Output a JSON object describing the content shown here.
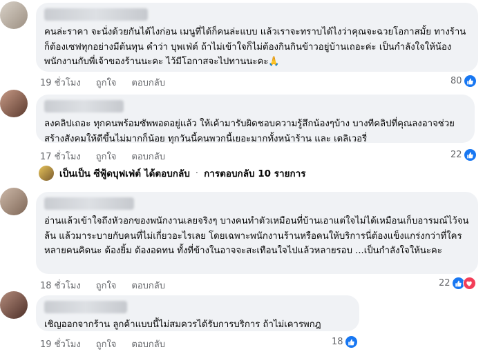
{
  "comments": [
    {
      "text": "คนล่ะราคา จะนั่งด้วยกันได้ไงก่อน เมนูที่ได้ก็คนล่ะแบบ แล้วเราจะทราบได้ไงว่าคุณจะฉวยโอกาสมั้ย ทางร้านก็ต้องเซฟทุกอย่างมีต้นทุน คำว่า บุพเฟ่ต์ ถ้าไม่เข้าใจก็ไม่ต้องกินกินข้าวอยู่บ้านเถอะค่ะ เป็นกำลังใจให้น้องพนักงานกับพี่เจ้าของร้านนะคะ ไว้มีโอกาสจะไปทานนะคะ🙏",
      "time": "19 ชั่วโมง",
      "like": "ถูกใจ",
      "reply": "ตอบกลับ",
      "reaction_count": "80"
    },
    {
      "text": "ลงคลิปเถอะ ทุกคนพร้อมซัพพอตอยู่แล้ว ให้เค้ามารับผิดชอบความรู้สึกน้องๆบ้าง บางทีคลิปที่คุณลงอาจช่วยสร้างสังคมให้ดีขึ้นไม่มากก็น้อย ทุกวันนี้คนพวกนี้เยอะมากทั้งหน้าร้าน และ เดลิเวอรี่",
      "time": "17 ชั่วโมง",
      "like": "ถูกใจ",
      "reply": "ตอบกลับ",
      "reaction_count": "22"
    },
    {
      "text": "อ่านแล้วเข้าใจถึงหัวอกของพนักงานเลยจริงๆ บางคนทำตัวเหมือนที่บ้านเอาแต่ใจไม่ได้เหมือนเก็บอารมณ์ไว้จนล้น แล้วมาระบายกับคนที่ไม่เกี่ยวอะไรเลย โดยเฉพาะพนักงานร้านหรือคนให้บริการนี่ต้องแข็งแกร่งกว่าที่ใครหลายคนคิดนะ ต้องยิ้ม ต้องอดทน ทั้งที่ข้างในอาจจะสะเทือนใจไปแล้วหลายรอบ ...เป็นกำลังใจให้นะคะ",
      "time": "18 ชั่วโมง",
      "like": "ถูกใจ",
      "reply": "ตอบกลับ",
      "reaction_count": "22"
    },
    {
      "text": "เชิญออกจากร้าน ลูกค้าแบบนี้ไม่สมควรได้รับการบริการ ถ้าไม่เคารพกฎ",
      "time": "19 ชั่วโมง",
      "like": "ถูกใจ",
      "reply": "ตอบกลับ",
      "reaction_count": "18"
    }
  ],
  "reply_summary": {
    "author": "เป็นเป็น ซีฟู้ดบุฟเฟ่ต์ ได้ตอบกลับ",
    "separator": "·",
    "count_text": "การตอบกลับ 10 รายการ"
  },
  "colors": {
    "bubble": "#f0f2f5",
    "like_blue": "#1877f2",
    "love_red": "#f33e58",
    "meta_gray": "#65676b"
  }
}
